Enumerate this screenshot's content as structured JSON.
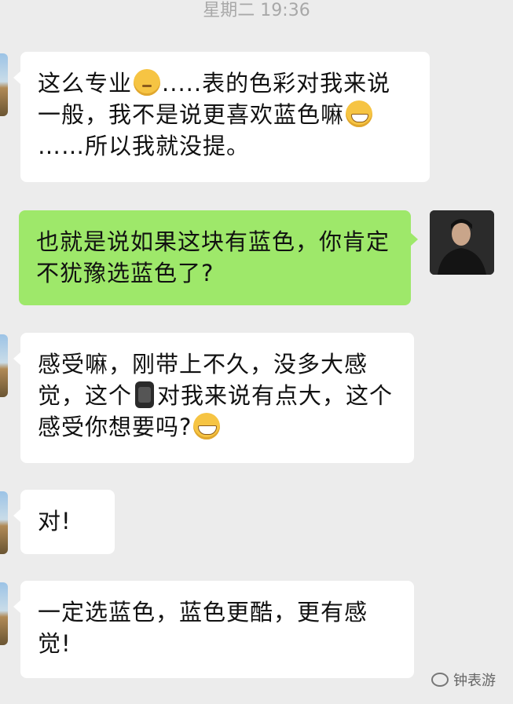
{
  "timestamp": "星期二 19:36",
  "messages": [
    {
      "side": "left",
      "parts": [
        "这么专业",
        "think-emoji",
        ".....表的色彩对我来说一般，我不是说更喜欢蓝色嘛",
        "grin-emoji",
        "……所以我就没提。"
      ]
    },
    {
      "side": "right",
      "text": "也就是说如果这块有蓝色，你肯定不犹豫选蓝色了?"
    },
    {
      "side": "left",
      "parts": [
        "感受嘛，刚带上不久，没多大感觉，这个",
        "watch-icon",
        "对我来说有点大，这个感受你想要吗?",
        "squint-emoji"
      ]
    },
    {
      "side": "left",
      "text": "对!"
    },
    {
      "side": "left",
      "text": "一定选蓝色，蓝色更酷，更有感觉!"
    }
  ],
  "m1": {
    "a": "这么专业",
    "b": ".....表的色彩对我来说一般，我不是说更喜欢蓝色嘛",
    "c": "……所以我就没提。"
  },
  "m2": {
    "text": "也就是说如果这块有蓝色，你肯定不犹豫选蓝色了?"
  },
  "m3": {
    "a": "感受嘛，刚带上不久，没多大感觉，这个",
    "b": "对我来说有点大，这个感受你想要吗?"
  },
  "m4": {
    "text": "对!"
  },
  "m5": {
    "text": "一定选蓝色，蓝色更酷，更有感觉!"
  },
  "watermark": {
    "text": "钟表游"
  },
  "colors": {
    "background": "#ececec",
    "incoming": "#ffffff",
    "outgoing": "#9ee86a",
    "timestamp": "#a8a8a8"
  }
}
